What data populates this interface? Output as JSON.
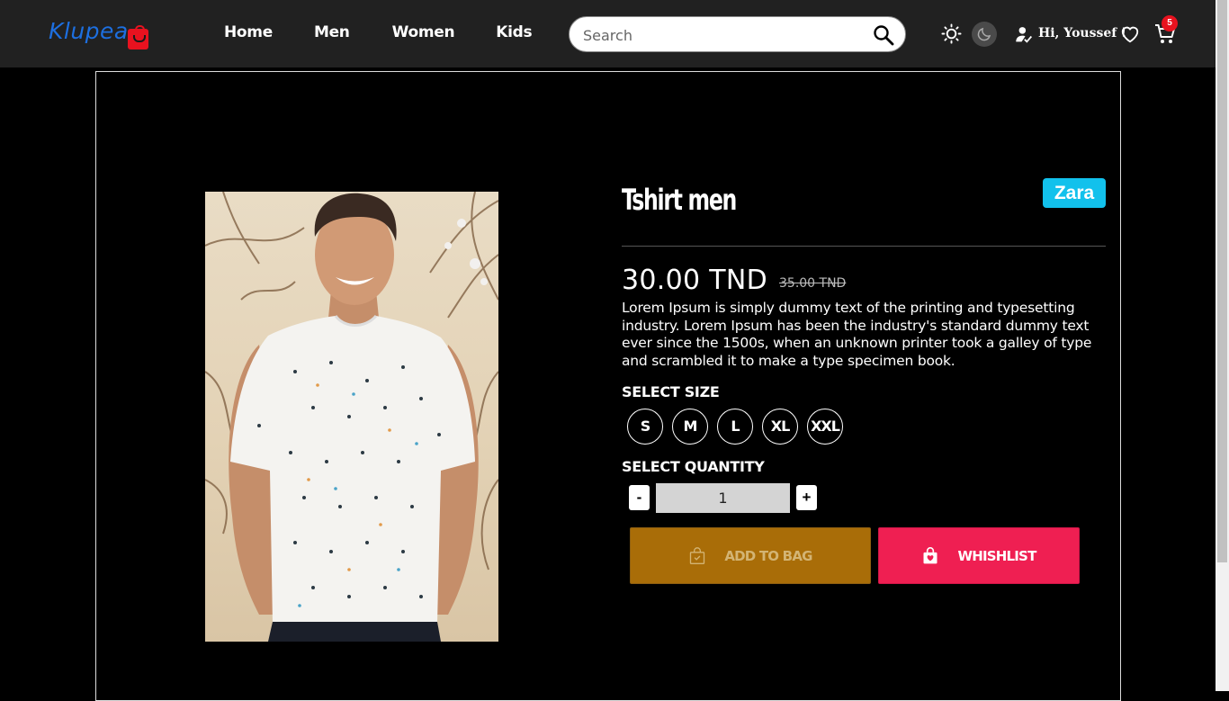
{
  "header": {
    "logo_text": "Klupea",
    "nav": [
      "Home",
      "Men",
      "Women",
      "Kids"
    ],
    "search_placeholder": "Search",
    "greeting": "Hi, Youssef !",
    "cart_count": "5"
  },
  "product": {
    "title": "Tshirt men",
    "brand": "Zara",
    "price": "30.00 TND",
    "old_price": "35.00 TND",
    "description": "Lorem Ipsum is simply dummy text of the printing and typesetting industry. Lorem Ipsum has been the industry's standard dummy text ever since the 1500s, when an unknown printer took a galley of type and scrambled it to make a type specimen book.",
    "size_label": "SELECT SIZE",
    "sizes": [
      "S",
      "M",
      "L",
      "XL",
      "XXL"
    ],
    "quantity_label": "SELECT QUANTITY",
    "quantity": "1",
    "minus": "-",
    "plus": "+",
    "add_to_bag": "ADD TO BAG",
    "wishlist": "WHISHLIST"
  },
  "colors": {
    "navbar": "#212121",
    "logo": "#1d6fe0",
    "brand_badge": "#12c1ec",
    "add_button": "#a96d08",
    "wishlist_button": "#ef1f52",
    "cart_badge": "#e8121f"
  }
}
